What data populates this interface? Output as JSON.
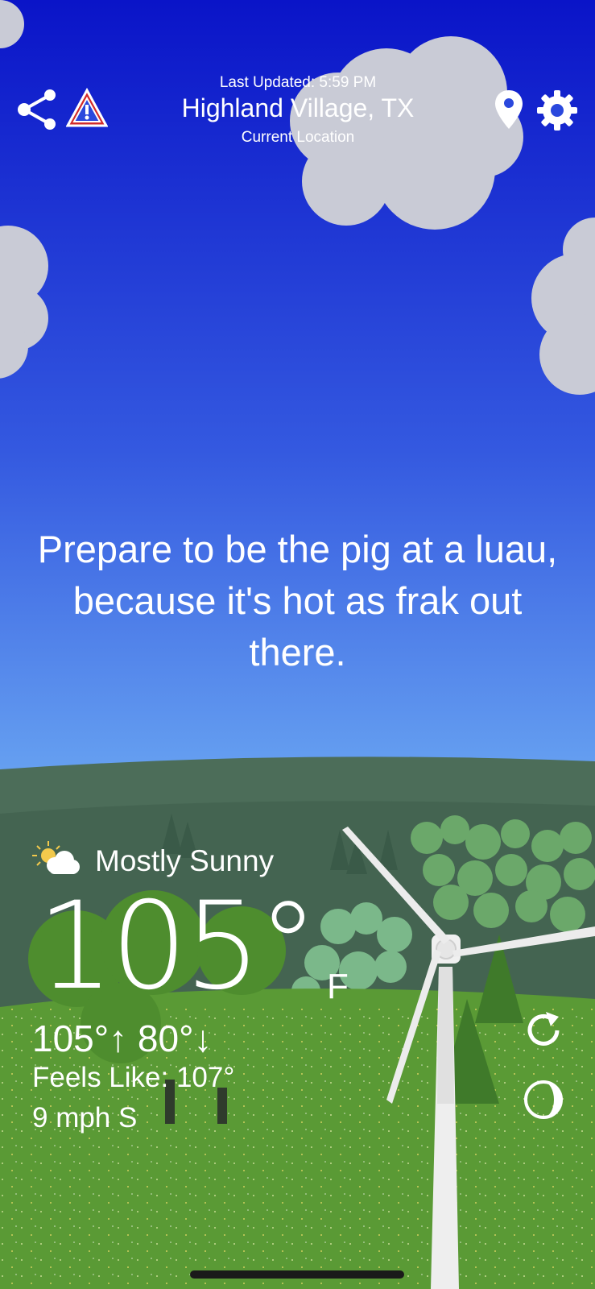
{
  "header": {
    "last_updated": "Last Updated: 5:59 PM",
    "location": "Highland Village, TX",
    "sublabel": "Current Location"
  },
  "message": "Prepare to be the pig at a luau, because it's hot as frak out there.",
  "current": {
    "condition": "Mostly Sunny",
    "condition_icon": "partly-sunny-icon",
    "temperature": "105°",
    "unit": "F",
    "high_low": "105°↑ 80°↓",
    "feels_like": "Feels Like: 107°",
    "wind": "9 mph S"
  },
  "icons": {
    "share": "share-icon",
    "alert": "warning-icon",
    "location": "location-pin-icon",
    "settings": "gear-icon",
    "refresh": "refresh-icon",
    "moon": "moon-phase-icon"
  },
  "colors": {
    "sky_top": "#0a14c8",
    "sky_bottom": "#6aa6f2",
    "hill_far": "#4c6d59",
    "grass": "#5a9a35",
    "alert": "#d22b2b"
  }
}
